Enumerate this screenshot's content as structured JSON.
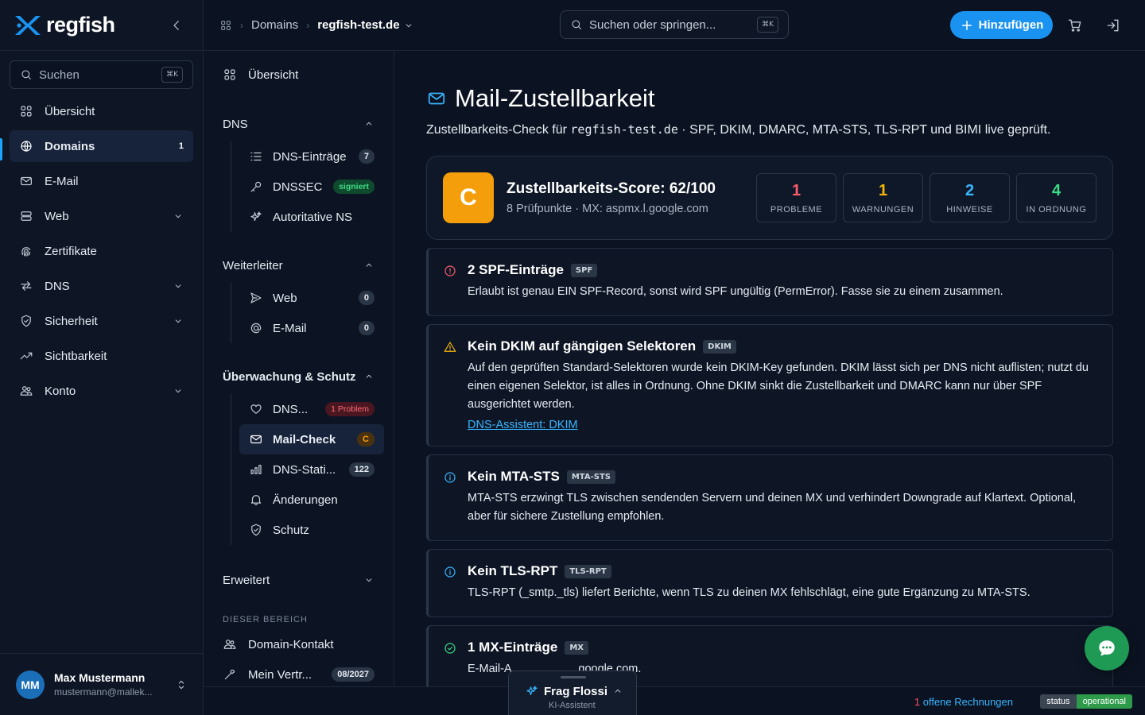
{
  "app": {
    "name": "regfish"
  },
  "sidebar": {
    "search_label": "Suchen",
    "search_kbd": "⌘K",
    "items": [
      {
        "label": "Übersicht",
        "icon": "grid-icon"
      },
      {
        "label": "Domains",
        "icon": "globe-icon",
        "badge": "1",
        "active": true
      },
      {
        "label": "E-Mail",
        "icon": "mail-icon"
      },
      {
        "label": "Web",
        "icon": "server-icon"
      },
      {
        "label": "Zertifikate",
        "icon": "fingerprint-icon"
      },
      {
        "label": "DNS",
        "icon": "arrows-icon"
      },
      {
        "label": "Sicherheit",
        "icon": "shield-icon"
      },
      {
        "label": "Sichtbarkeit",
        "icon": "trend-icon"
      },
      {
        "label": "Konto",
        "icon": "users-icon"
      }
    ],
    "user": {
      "initials": "MM",
      "name": "Max Mustermann",
      "email": "mustermann@mallek..."
    }
  },
  "topbar": {
    "breadcrumb_domains": "Domains",
    "breadcrumb_current": "regfish-test.de",
    "search_placeholder": "Suchen oder springen...",
    "search_kbd": "⌘K",
    "add_label": "Hinzufügen"
  },
  "subnav": {
    "overview": "Übersicht",
    "dns_heading": "DNS",
    "dns_items": [
      {
        "label": "DNS-Einträge",
        "badge": "7"
      },
      {
        "label": "DNSSEC",
        "badge": "signiert"
      },
      {
        "label": "Autoritative NS"
      }
    ],
    "forward_heading": "Weiterleiter",
    "forward_items": [
      {
        "label": "Web",
        "badge": "0"
      },
      {
        "label": "E-Mail",
        "badge": "0"
      }
    ],
    "monitor_heading": "Überwachung & Schutz",
    "monitor_items": [
      {
        "label": "DNS...",
        "badge": "1 Problem"
      },
      {
        "label": "Mail-Check",
        "badge": "C"
      },
      {
        "label": "DNS-Stati...",
        "badge": "122"
      },
      {
        "label": "Änderungen"
      },
      {
        "label": "Schutz"
      }
    ],
    "advanced_heading": "Erweitert",
    "area_caption": "DIESER BEREICH",
    "area_items": [
      {
        "label": "Domain-Kontakt"
      },
      {
        "label": "Mein Vertr...",
        "badge": "08/2027"
      }
    ]
  },
  "main": {
    "title": "Mail-Zustellbarkeit",
    "subtitle_prefix": "Zustellbarkeits-Check für ",
    "subtitle_domain": "regfish-test.de",
    "subtitle_suffix": " · SPF, DKIM, DMARC, MTA-STS, TLS-RPT und BIMI live geprüft.",
    "score": {
      "grade": "C",
      "title": "Zustellbarkeits-Score: 62/100",
      "meta": "8 Prüfpunkte · MX: aspmx.l.google.com",
      "stats": [
        {
          "num": "1",
          "label": "PROBLEME",
          "color": "#ff5c6c"
        },
        {
          "num": "1",
          "label": "WARNUNGEN",
          "color": "#f5b50b"
        },
        {
          "num": "2",
          "label": "HINWEISE",
          "color": "#38b6ff"
        },
        {
          "num": "4",
          "label": "IN ORDNUNG",
          "color": "#3ddc84"
        }
      ]
    },
    "issues": [
      {
        "title": "2 SPF-Einträge",
        "tag": "SPF",
        "desc": "Erlaubt ist genau EIN SPF-Record, sonst wird SPF ungültig (PermError). Fasse sie zu einem zusammen.",
        "icon": "error-icon",
        "color": "#ff5c6c"
      },
      {
        "title": "Kein DKIM auf gängigen Selektoren",
        "tag": "DKIM",
        "desc": "Auf den geprüften Standard-Selektoren wurde kein DKIM-Key gefunden. DKIM lässt sich per DNS nicht auflisten; nutzt du einen eigenen Selektor, ist alles in Ordnung. Ohne DKIM sinkt die Zustellbarkeit und DMARC kann nur über SPF ausgerichtet werden.",
        "link": "DNS-Assistent: DKIM",
        "icon": "warning-icon",
        "color": "#f5b50b"
      },
      {
        "title": "Kein MTA-STS",
        "tag": "MTA-STS",
        "desc": "MTA-STS erzwingt TLS zwischen sendenden Servern und deinen MX und verhindert Downgrade auf Klartext. Optional, aber für sichere Zustellung empfohlen.",
        "icon": "info-icon",
        "color": "#38b6ff"
      },
      {
        "title": "Kein TLS-RPT",
        "tag": "TLS-RPT",
        "desc": "TLS-RPT (_smtp._tls) liefert Berichte, wenn TLS zu deinen MX fehlschlägt, eine gute Ergänzung zu MTA-STS.",
        "icon": "info-icon",
        "color": "#38b6ff"
      },
      {
        "title": "1 MX-Einträge",
        "tag": "MX",
        "desc": "E-Mail-A                    .google.com.",
        "icon": "check-icon",
        "color": "#3ddc84"
      }
    ]
  },
  "footer": {
    "invoice_count": "1",
    "invoice_label": " offene Rechnungen",
    "status_key": "status",
    "status_value": "operational"
  },
  "assistant": {
    "name": "Frag Flossi",
    "subtitle": "KI-Assistent"
  }
}
